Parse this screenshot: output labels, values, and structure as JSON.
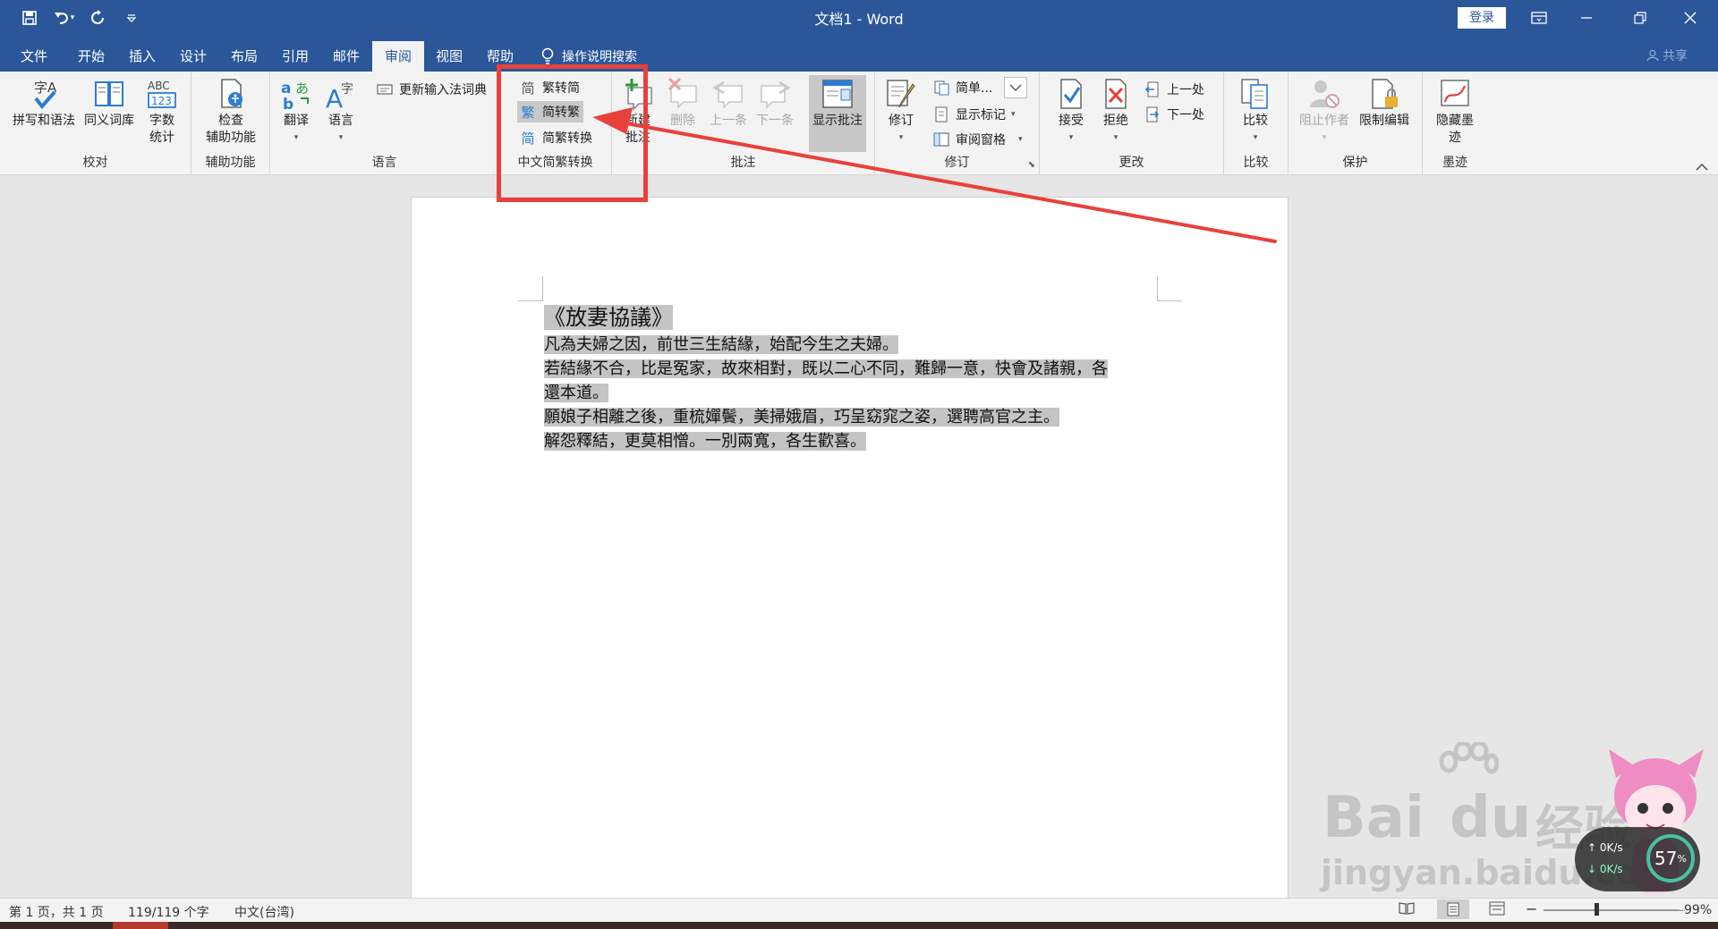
{
  "titlebar": {
    "title": "文档1 - Word",
    "login": "登录",
    "icons": [
      "save-icon",
      "undo-icon",
      "redo-icon",
      "customize-qat-icon",
      "ribbon-display-icon",
      "minimize-icon",
      "restore-icon",
      "close-icon"
    ]
  },
  "tabs": [
    "文件",
    "开始",
    "插入",
    "设计",
    "布局",
    "引用",
    "邮件",
    "审阅",
    "视图",
    "帮助"
  ],
  "active_tab": "审阅",
  "tell_me": "操作说明搜索",
  "share": "共享",
  "ribbon": {
    "proofing": {
      "label": "校对",
      "spelling": "拼写和语法",
      "thesaurus": "同义词库",
      "wordcount_1": "字数",
      "wordcount_2": "统计"
    },
    "accessibility": {
      "label": "辅助功能",
      "check_1": "检查",
      "check_2": "辅助功能"
    },
    "language": {
      "label": "语言",
      "translate": "翻译",
      "language": "语言",
      "update_ime": "更新输入法词典"
    },
    "chinese_conversion": {
      "label": "中文简繁转换",
      "to_simplified": "繁转简",
      "to_traditional": "简转繁",
      "convert": "简繁转换"
    },
    "comments": {
      "label": "批注",
      "new_1": "新建",
      "new_2": "批注",
      "delete": "删除",
      "previous": "上一条",
      "next": "下一条",
      "show": "显示批注"
    },
    "tracking": {
      "label": "修订",
      "track": "修订",
      "markup_select": "简单...",
      "show_markup": "显示标记",
      "review_pane": "审阅窗格"
    },
    "changes": {
      "label": "更改",
      "accept": "接受",
      "reject": "拒绝",
      "previous": "上一处",
      "next": "下一处"
    },
    "compare": {
      "label": "比较",
      "compare": "比较"
    },
    "protect": {
      "label": "保护",
      "block_authors": "阻止作者",
      "restrict": "限制编辑"
    },
    "ink": {
      "label": "墨迹",
      "hide_ink_1": "隐藏墨",
      "hide_ink_2": "迹"
    }
  },
  "document": {
    "title": "《放妻協議》",
    "lines": [
      "凡為夫婦之因，前世三生結緣，始配今生之夫婦。",
      "若結緣不合，比是冤家，故來相對，既以二心不同，難歸一意，快會及諸親，各",
      "還本道。",
      "願娘子相離之後，重梳嬋鬢，美掃娥眉，巧呈窈窕之姿，選聘高官之主。",
      "解怨釋結，更莫相憎。一別兩寬，各生歡喜。"
    ]
  },
  "status": {
    "page": "第 1 页，共 1 页",
    "words": "119/119 个字",
    "language": "中文(台湾)",
    "zoom": "99%"
  },
  "watermark": {
    "brand": "Bai",
    "brand_mid": "du",
    "brand_cn": "经验",
    "url": "jingyan.baidu.com"
  },
  "netbadge": {
    "speed_up": "0K/s",
    "speed_down": "0K/s",
    "percent": "57",
    "percent_sign": "%"
  },
  "colors": {
    "titlebar": "#2b579a",
    "ribbon": "#f3f3f3",
    "highlight": "#c4c4c4",
    "annotation": "#e8413c"
  }
}
